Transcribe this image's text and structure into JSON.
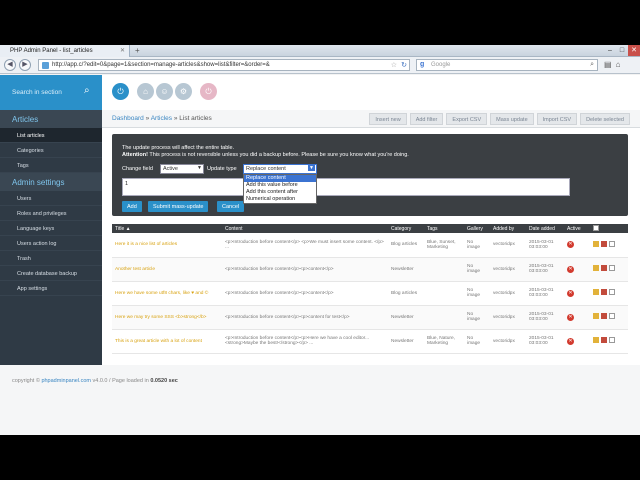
{
  "browser": {
    "tab_title": "PHP Admin Panel - list_articles",
    "url": "http://app.c/?edit=0&page=1&section=manage-articles&show=list&filter=&order=&",
    "search_placeholder": "Google"
  },
  "sidebar": {
    "search_placeholder": "Search in section",
    "sections": [
      {
        "title": "Articles",
        "items": [
          {
            "label": "List articles",
            "active": true
          },
          {
            "label": "Categories"
          },
          {
            "label": "Tags"
          }
        ]
      },
      {
        "title": "Admin settings",
        "items": [
          {
            "label": "Users"
          },
          {
            "label": "Roles and privileges"
          },
          {
            "label": "Language keys"
          },
          {
            "label": "Users action log"
          },
          {
            "label": "Trash"
          },
          {
            "label": "Create database backup"
          },
          {
            "label": "App settings"
          }
        ]
      }
    ]
  },
  "breadcrumb": {
    "home": "Dashboard",
    "section": "Articles",
    "page": "List articles",
    "sep": "»"
  },
  "toolbar": [
    "Insert new",
    "Add filter",
    "Export CSV",
    "Mass update",
    "Import CSV",
    "Delete selected"
  ],
  "update_panel": {
    "line1": "The update process will affect the entire table.",
    "attention_label": "Attention!",
    "attention_text": " This process is not reversible unless you did a backup before. Please be sure you know what you're doing.",
    "change_field_label": "Change field",
    "change_field_value": "Active",
    "update_type_label": "Update type",
    "update_type_value": "Replace content",
    "textarea_value": "1",
    "dropdown_options": [
      "Replace content",
      "Add this value before",
      "Add this content after",
      "Numerical operation"
    ],
    "buttons": {
      "add": "Add",
      "submit": "Submit mass-update",
      "cancel": "Cancel"
    }
  },
  "table": {
    "headers": [
      "Title ▲",
      "Content",
      "Category",
      "Tags",
      "Gallery",
      "Added by",
      "Date added",
      "Active",
      ""
    ],
    "rows": [
      {
        "title": "Here it is a nice list of articles",
        "content": "<p>Introduction before content</p> <p>We must insert some content. </p> ...",
        "category": "Blog articles",
        "tags": "Blue, Sunset, Marketing",
        "gallery": "No image",
        "added_by": "vectoridpx",
        "date": "2015-03-01 03:03:00"
      },
      {
        "title": "Another test article",
        "content": "<p>Introduction before content</p><p>content</p>",
        "category": "Newsletter",
        "tags": "",
        "gallery": "No image",
        "added_by": "vectoridpx",
        "date": "2015-03-01 03:03:00"
      },
      {
        "title": "Here we have some utf8 chars, like ♥ and ©",
        "content": "<p>Introduction before content</p><p>content</p>",
        "category": "Blog articles",
        "tags": "",
        "gallery": "No image",
        "added_by": "vectoridpx",
        "date": "2015-03-01 03:03:00"
      },
      {
        "title": "Here we may try some SSS <b>strong</b>",
        "content": "<p>Introduction before content</p><p>content for test</p>",
        "category": "Newsletter",
        "tags": "",
        "gallery": "No image",
        "added_by": "vectoridpx",
        "date": "2015-03-01 03:03:00"
      },
      {
        "title": "This is a great article with a lot of content",
        "content": "<p>Introduction before content</p><p>Here we have a cool editor... <strong>Maybe the best!</strong></p> ...",
        "category": "Newsletter",
        "tags": "Blue, Nature, Marketing",
        "gallery": "No image",
        "added_by": "vectoridpx",
        "date": "2015-03-01 03:03:00"
      }
    ]
  },
  "footer": {
    "prefix": "copyright ©",
    "link": "phpadminpanel.com",
    "mid": " v4.0.0 / Page loaded in ",
    "time": "0.0520 sec"
  }
}
